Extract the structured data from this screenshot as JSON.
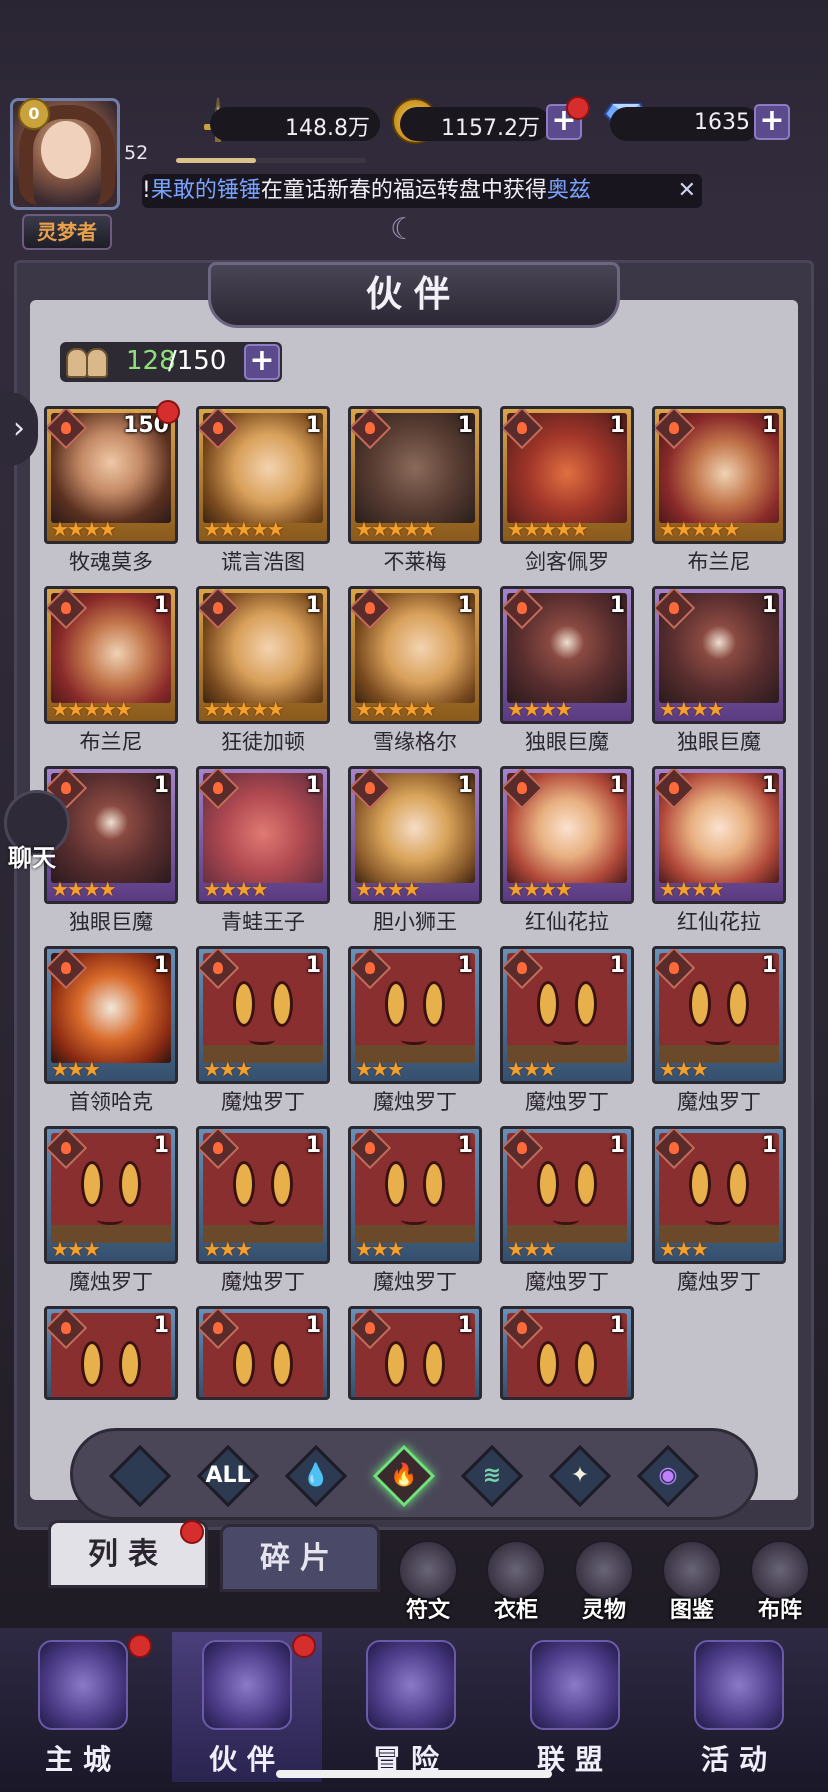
{
  "player": {
    "vip": "0",
    "level": "52",
    "title": "灵梦者",
    "xp_fraction": 0.42
  },
  "resources": {
    "power": "148.8万",
    "gold": "1157.2万",
    "gems": "1635",
    "coin_glyph": "G"
  },
  "ticker": {
    "prefix": "!",
    "player": "果敢的锤锤",
    "text": "在童话新春的福运转盘中获得",
    "item": "奥兹",
    "close": "✕"
  },
  "page_title": "伙伴",
  "capacity": {
    "current": "128",
    "max": "/150"
  },
  "heroes": [
    {
      "name": "牧魂莫多",
      "count": "150",
      "stars": "★★★★",
      "frame": "gold",
      "art": "p-human",
      "badge": true
    },
    {
      "name": "谎言浩图",
      "count": "1",
      "stars": "★★★★★",
      "frame": "gold",
      "art": "p-blonde"
    },
    {
      "name": "不莱梅",
      "count": "1",
      "stars": "★★★★★",
      "frame": "gold",
      "art": "p-horse"
    },
    {
      "name": "剑客佩罗",
      "count": "1",
      "stars": "★★★★★",
      "frame": "gold",
      "art": "p-fox"
    },
    {
      "name": "布兰尼",
      "count": "1",
      "stars": "★★★★★",
      "frame": "gold",
      "art": "p-red"
    },
    {
      "name": "布兰尼",
      "count": "1",
      "stars": "★★★★★",
      "frame": "gold",
      "art": "p-red"
    },
    {
      "name": "狂徒加顿",
      "count": "1",
      "stars": "★★★★★",
      "frame": "gold",
      "art": "p-blonde"
    },
    {
      "name": "雪缘格尔",
      "count": "1",
      "stars": "★★★★★",
      "frame": "gold",
      "art": "p-blonde"
    },
    {
      "name": "独眼巨魔",
      "count": "1",
      "stars": "★★★★",
      "frame": "purple",
      "art": "p-cyclops"
    },
    {
      "name": "独眼巨魔",
      "count": "1",
      "stars": "★★★★",
      "frame": "purple",
      "art": "p-cyclops"
    },
    {
      "name": "独眼巨魔",
      "count": "1",
      "stars": "★★★★",
      "frame": "purple",
      "art": "p-cyclops"
    },
    {
      "name": "青蛙王子",
      "count": "1",
      "stars": "★★★★",
      "frame": "purple",
      "art": "p-frog"
    },
    {
      "name": "胆小狮王",
      "count": "1",
      "stars": "★★★★",
      "frame": "purple",
      "art": "p-lion"
    },
    {
      "name": "红仙花拉",
      "count": "1",
      "stars": "★★★★",
      "frame": "purple",
      "art": "p-flower"
    },
    {
      "name": "红仙花拉",
      "count": "1",
      "stars": "★★★★",
      "frame": "purple",
      "art": "p-flower"
    },
    {
      "name": "首领哈克",
      "count": "1",
      "stars": "★★★",
      "frame": "blue",
      "art": "p-hakker"
    },
    {
      "name": "魔烛罗丁",
      "count": "1",
      "stars": "★★★",
      "frame": "blue",
      "art": "p-candle"
    },
    {
      "name": "魔烛罗丁",
      "count": "1",
      "stars": "★★★",
      "frame": "blue",
      "art": "p-candle"
    },
    {
      "name": "魔烛罗丁",
      "count": "1",
      "stars": "★★★",
      "frame": "blue",
      "art": "p-candle"
    },
    {
      "name": "魔烛罗丁",
      "count": "1",
      "stars": "★★★",
      "frame": "blue",
      "art": "p-candle"
    },
    {
      "name": "魔烛罗丁",
      "count": "1",
      "stars": "★★★",
      "frame": "blue",
      "art": "p-candle"
    },
    {
      "name": "魔烛罗丁",
      "count": "1",
      "stars": "★★★",
      "frame": "blue",
      "art": "p-candle"
    },
    {
      "name": "魔烛罗丁",
      "count": "1",
      "stars": "★★★",
      "frame": "blue",
      "art": "p-candle"
    },
    {
      "name": "魔烛罗丁",
      "count": "1",
      "stars": "★★★",
      "frame": "blue",
      "art": "p-candle"
    },
    {
      "name": "魔烛罗丁",
      "count": "1",
      "stars": "★★★",
      "frame": "blue",
      "art": "p-candle"
    },
    {
      "name": "",
      "count": "1",
      "stars": "",
      "frame": "blue",
      "art": "p-candle"
    },
    {
      "name": "",
      "count": "1",
      "stars": "",
      "frame": "blue",
      "art": "p-candle"
    },
    {
      "name": "",
      "count": "1",
      "stars": "",
      "frame": "blue",
      "art": "p-candle"
    },
    {
      "name": "",
      "count": "1",
      "stars": "",
      "frame": "blue",
      "art": "p-candle"
    }
  ],
  "filters": [
    {
      "id": "earth",
      "label": "",
      "color": "#6fa0c8"
    },
    {
      "id": "all",
      "label": "ALL",
      "color": "#ffffff"
    },
    {
      "id": "water",
      "label": "💧",
      "color": "#6fb0ff"
    },
    {
      "id": "fire",
      "label": "🔥",
      "color": "#ff5a3a",
      "active": true
    },
    {
      "id": "wind",
      "label": "≋",
      "color": "#7ad0b0"
    },
    {
      "id": "light",
      "label": "✦",
      "color": "#f4f0e0"
    },
    {
      "id": "dark",
      "label": "◉",
      "color": "#c080ff"
    }
  ],
  "tabs": {
    "list": "列表",
    "fragments": "碎片"
  },
  "quick_actions": [
    "符文",
    "衣柜",
    "灵物",
    "图鉴",
    "布阵"
  ],
  "nav": [
    "主城",
    "伙伴",
    "冒险",
    "联盟",
    "活动"
  ],
  "chat": "聊天",
  "side_arrow": "›",
  "colors": {
    "accent_green": "#8fe07a",
    "highlight_blue": "#7aa3ff",
    "star": "#f2a02e"
  }
}
